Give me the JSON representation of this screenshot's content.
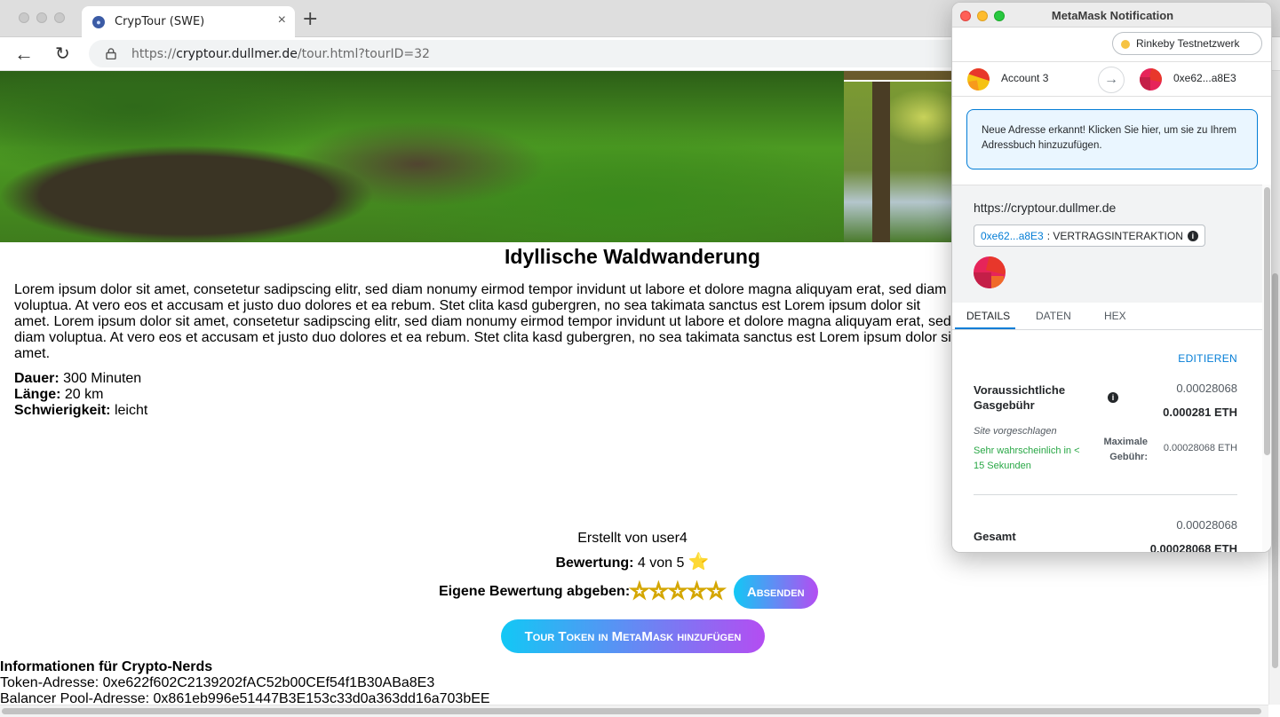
{
  "browser": {
    "tab_title": "CrypTour (SWE)",
    "tab_close": "×",
    "new_tab": "+",
    "back": "←",
    "reload": "↻",
    "url_prefix": "https://",
    "url_host": "cryptour.dullmer.de",
    "url_path": "/tour.html?tourID=32"
  },
  "tour": {
    "title": "Idyllische Waldwanderung",
    "description": "Lorem ipsum dolor sit amet, consetetur sadipscing elitr, sed diam nonumy eirmod tempor invidunt ut labore et dolore magna aliquyam erat, sed diam voluptua. At vero eos et accusam et justo duo dolores et ea rebum. Stet clita kasd gubergren, no sea takimata sanctus est Lorem ipsum dolor sit amet. Lorem ipsum dolor sit amet, consetetur sadipscing elitr, sed diam nonumy eirmod tempor invidunt ut labore et dolore magna aliquyam erat, sed diam voluptua. At vero eos et accusam et justo duo dolores et ea rebum. Stet clita kasd gubergren, no sea takimata sanctus est Lorem ipsum dolor sit amet.",
    "duration_label": "Dauer:",
    "duration_value": "300 Minuten",
    "length_label": "Länge:",
    "length_value": "20 km",
    "difficulty_label": "Schwierigkeit:",
    "difficulty_value": "leicht",
    "created_by": "Erstellt von user4",
    "rating_label": "Bewertung:",
    "rating_value": "4 von 5",
    "rating_star": "⭐",
    "own_rating_label": "Eigene Bewertung abgeben:",
    "own_rating_stars": [
      "☆",
      "☆",
      "☆",
      "☆",
      "☆"
    ],
    "submit_label": "Absenden",
    "token_button_label": "Tour Token in MetaMask hinzufügen",
    "nerds_title": "Informationen für Crypto-Nerds",
    "token_address_line": "Token-Adresse: 0xe622f602C2139202fAC52b00CEf54f1B30ABa8E3",
    "pool_address_line": "Balancer Pool-Adresse: 0x861eb996e51447B3E153c33d0a363dd16a703bEE"
  },
  "metamask": {
    "window_title": "MetaMask Notification",
    "network": "Rinkeby Testnetzwerk",
    "from_account": "Account 3",
    "arrow": "→",
    "to_account": "0xe62...a8E3",
    "notice": "Neue Adresse erkannt! Klicken Sie hier, um sie zu Ihrem Adressbuch hinzuzufügen.",
    "origin": "https://cryptour.dullmer.de",
    "contract_addr": "0xe62...a8E3",
    "contract_type": ": VERTRAGSINTERAKTION",
    "info_glyph": "i",
    "tabs": [
      "DETAILS",
      "DATEN",
      "HEX"
    ],
    "edit_label": "EDITIEREN",
    "gas_label": "Voraussichtliche Gasgebühr",
    "gas_secondary": "0.00028068",
    "gas_primary": "0.000281 ETH",
    "site_suggested": "Site vorgeschlagen",
    "speed_text": "Sehr wahrscheinlich in < 15 Sekunden",
    "max_fee_label": "Maximale Gebühr:",
    "max_fee_value": "0.00028068 ETH",
    "total_label": "Gesamt",
    "total_secondary": "0.00028068",
    "total_primary": "0.00028068 ETH"
  }
}
